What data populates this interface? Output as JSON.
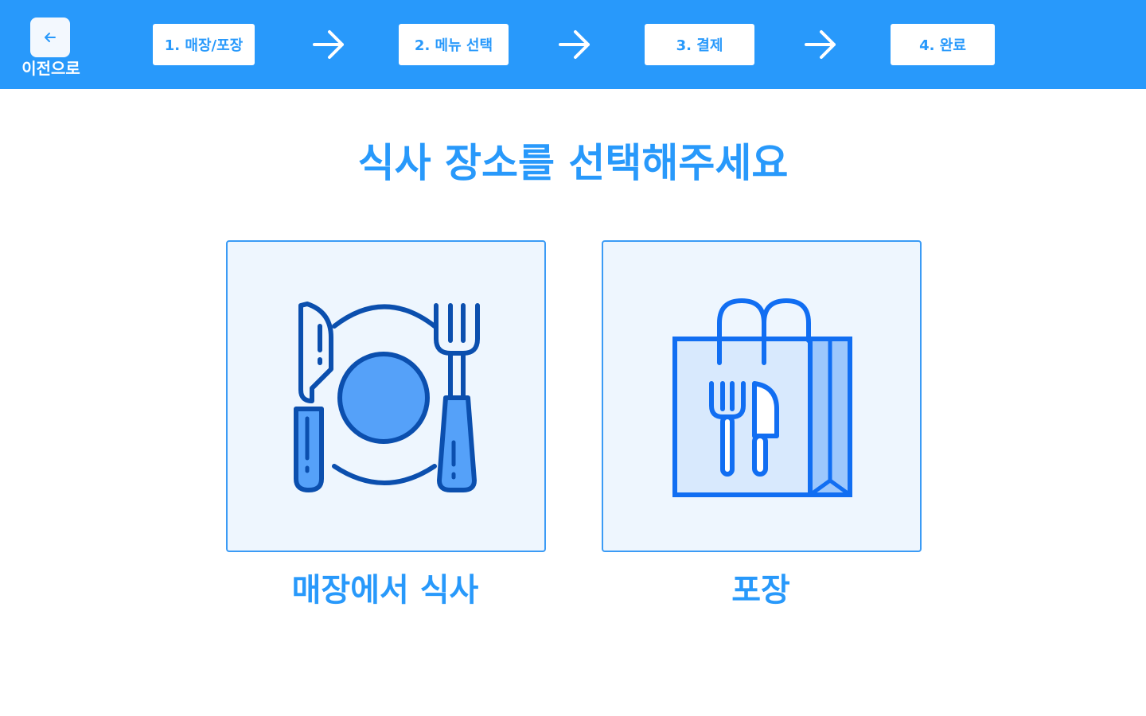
{
  "header": {
    "back_label": "이전으로",
    "back_icon": "arrow-left-icon",
    "steps": [
      {
        "label": "1. 매장/포장"
      },
      {
        "label": "2. 메뉴 선택"
      },
      {
        "label": "3. 결제"
      },
      {
        "label": "4. 완료"
      }
    ],
    "step_arrow_icon": "arrow-right-icon"
  },
  "main": {
    "title": "식사 장소를 선택해주세요",
    "options": [
      {
        "label": "매장에서 식사",
        "icon": "plate-cutlery-icon"
      },
      {
        "label": "포장",
        "icon": "takeout-bag-icon"
      }
    ]
  },
  "colors": {
    "primary": "#2899fb",
    "card_bg": "#eef6fe",
    "card_border": "#3b9bf5",
    "icon_dark": "#0b4fae",
    "icon_fill": "#55a1f9",
    "bag_stroke": "#116ef2",
    "bag_fill": "#d8e9fd"
  }
}
